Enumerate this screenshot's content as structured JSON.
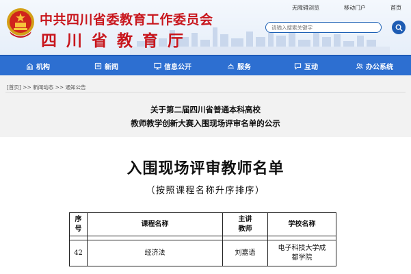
{
  "header": {
    "title": "中共四川省委教育工作委员会",
    "subtitle": "四川省教育厅",
    "top_links": [
      "无障碍浏览",
      "移动门户",
      "首页"
    ],
    "search_placeholder": "请输入搜索关键字"
  },
  "nav": {
    "items": [
      {
        "label": "机构",
        "icon": "building-icon"
      },
      {
        "label": "新闻",
        "icon": "news-icon"
      },
      {
        "label": "信息公开",
        "icon": "monitor-icon"
      },
      {
        "label": "服务",
        "icon": "service-icon"
      },
      {
        "label": "互动",
        "icon": "chat-icon"
      },
      {
        "label": "办公系统",
        "icon": "users-icon"
      }
    ]
  },
  "breadcrumb": {
    "home": "[首页]",
    "separator": ">>",
    "news": "新闻动态",
    "notice": "通知公告"
  },
  "notice": {
    "title_line1": "关于第二届四川省普通本科高校",
    "title_line2": "教师教学创新大赛入围现场评审名单的公示"
  },
  "document": {
    "title": "入围现场评审教师名单",
    "subtitle": "（按照课程名称升序排序）",
    "table": {
      "headers": {
        "seq": [
          "序",
          "号"
        ],
        "course": "课程名称",
        "teacher": [
          "主讲",
          "教师"
        ],
        "school": "学校名称"
      },
      "rows": [
        {
          "seq": "42",
          "course": "经济法",
          "teacher": "刘嘉语",
          "school_line1": "电子科技大学成",
          "school_line2": "都学院"
        }
      ]
    }
  },
  "colors": {
    "brand_red": "#c8161d",
    "nav_blue": "#2d6fd1"
  }
}
